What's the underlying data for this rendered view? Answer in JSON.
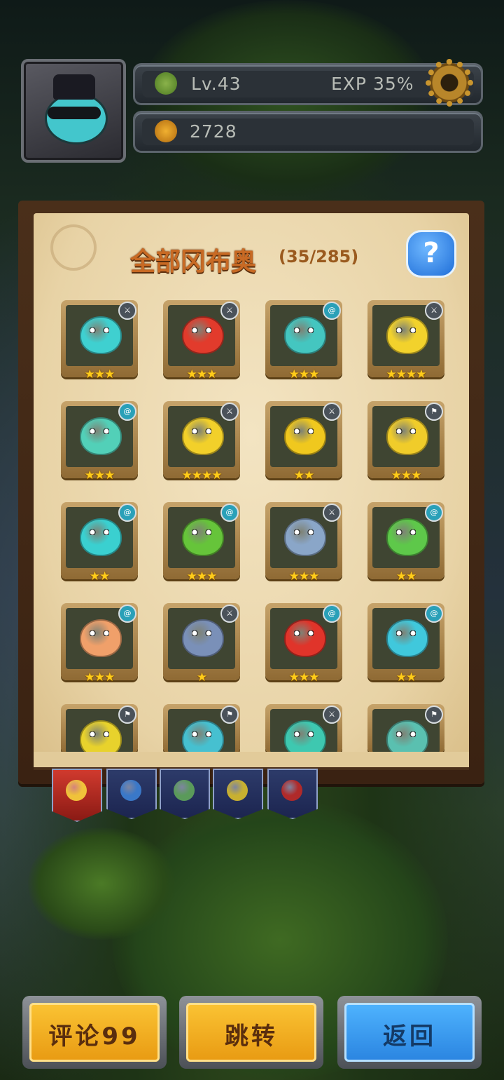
{
  "hud": {
    "level": "Lv.43",
    "exp": "EXP 35%",
    "currency": "2728"
  },
  "collection": {
    "title": "全部冈布奥",
    "count": "(35/285)",
    "help": "?"
  },
  "cards": [
    {
      "color": "#3fd0d0",
      "badge": "sword",
      "stars": "★★★",
      "star_count": 3
    },
    {
      "color": "#e23b2c",
      "badge": "sword",
      "stars": "★★★",
      "star_count": 3
    },
    {
      "color": "#44c6c0",
      "badge": "spiral",
      "stars": "★★★",
      "star_count": 3
    },
    {
      "color": "#f2d22c",
      "badge": "sword",
      "stars": "★★★★",
      "star_count": 4
    },
    {
      "color": "#52d0b8",
      "badge": "spiral",
      "stars": "★★★",
      "star_count": 3
    },
    {
      "color": "#f2d02a",
      "badge": "sword",
      "stars": "★★★★",
      "star_count": 4
    },
    {
      "color": "#f0c81e",
      "badge": "sword",
      "stars": "★★",
      "star_count": 2
    },
    {
      "color": "#f0cc2a",
      "badge": "flag",
      "stars": "★★★",
      "star_count": 3
    },
    {
      "color": "#3ad0d0",
      "badge": "spiral",
      "stars": "★★",
      "star_count": 2
    },
    {
      "color": "#66c43a",
      "badge": "spiral",
      "stars": "★★★",
      "star_count": 3
    },
    {
      "color": "#8aa6c8",
      "badge": "sword",
      "stars": "★★★",
      "star_count": 3
    },
    {
      "color": "#5ec84a",
      "badge": "spiral",
      "stars": "★★",
      "star_count": 2
    },
    {
      "color": "#f0a06a",
      "badge": "spiral",
      "stars": "★★★",
      "star_count": 3
    },
    {
      "color": "#7a90b8",
      "badge": "sword",
      "stars": "★",
      "star_count": 1
    },
    {
      "color": "#e0342a",
      "badge": "spiral",
      "stars": "★★★",
      "star_count": 3
    },
    {
      "color": "#40c8dc",
      "badge": "spiral",
      "stars": "★★",
      "star_count": 2
    },
    {
      "color": "#e8d22c",
      "badge": "flag",
      "stars": "",
      "star_count": 0
    },
    {
      "color": "#46c0d0",
      "badge": "flag",
      "stars": "",
      "star_count": 0
    },
    {
      "color": "#3ec8b0",
      "badge": "sword",
      "stars": "",
      "star_count": 0
    },
    {
      "color": "#5ac0b0",
      "badge": "flag",
      "stars": "",
      "star_count": 0
    }
  ],
  "tabs": [
    {
      "name": "all",
      "color": "#f0c23a",
      "active": true
    },
    {
      "name": "blue",
      "color": "#3a78c8",
      "active": false
    },
    {
      "name": "green",
      "color": "#5a9a5a",
      "active": false
    },
    {
      "name": "yellow",
      "color": "#c8b030",
      "active": false
    },
    {
      "name": "red",
      "color": "#b02a2a",
      "active": false
    }
  ],
  "buttons": {
    "comment": "评论99",
    "jump": "跳转",
    "back": "返回"
  }
}
